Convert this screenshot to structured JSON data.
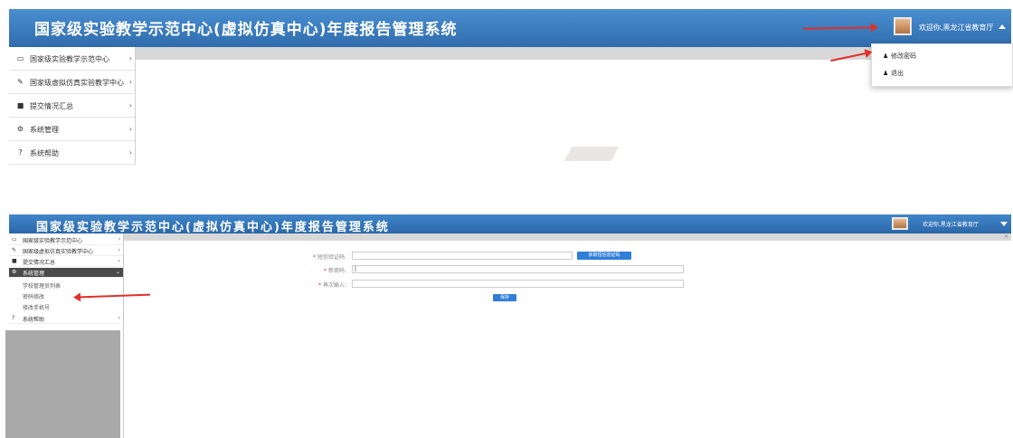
{
  "app": {
    "title": "国家级实验教学示范中心(虚拟仿真中心)年度报告管理系统",
    "user_greeting": "欢迎你,黑龙江省教育厅"
  },
  "top_sidebar": [
    {
      "icon": "monitor-icon",
      "glyph": "▭",
      "label": "国家级实验教学示范中心"
    },
    {
      "icon": "edit-icon",
      "glyph": "✎",
      "label": "国家级虚拟仿真实验教学中心"
    },
    {
      "icon": "file-icon",
      "glyph": "■",
      "label": "提交情况汇总"
    },
    {
      "icon": "gears-icon",
      "glyph": "⚙",
      "label": "系统管理"
    },
    {
      "icon": "help-icon",
      "glyph": "?",
      "label": "系统帮助"
    }
  ],
  "user_menu": {
    "change_password": "修改密码",
    "logout": "退出"
  },
  "bottom_sidebar": {
    "items": [
      {
        "icon": "monitor-icon",
        "glyph": "▭",
        "label": "国家级实验教学示范中心"
      },
      {
        "icon": "edit-icon",
        "glyph": "✎",
        "label": "国家级虚拟仿真实验教学中心"
      },
      {
        "icon": "file-icon",
        "glyph": "■",
        "label": "提交情况汇总"
      },
      {
        "icon": "gears-icon",
        "glyph": "⚙",
        "label": "系统管理"
      }
    ],
    "sub_items": [
      "学校管理员列表",
      "密码修改",
      "修改手机号"
    ],
    "help": {
      "icon": "help-icon",
      "glyph": "?",
      "label": "系统帮助"
    }
  },
  "password_form": {
    "sms_code_label": "短信验证码:",
    "get_code_button": "获取短信验证码",
    "new_password_label": "新密码:",
    "new_password_value": "|",
    "confirm_label": "再次输入:",
    "save_button": "保存"
  },
  "colors": {
    "banner": "#2f6cad",
    "arrow": "#e0302a",
    "button": "#2f7ed8"
  }
}
